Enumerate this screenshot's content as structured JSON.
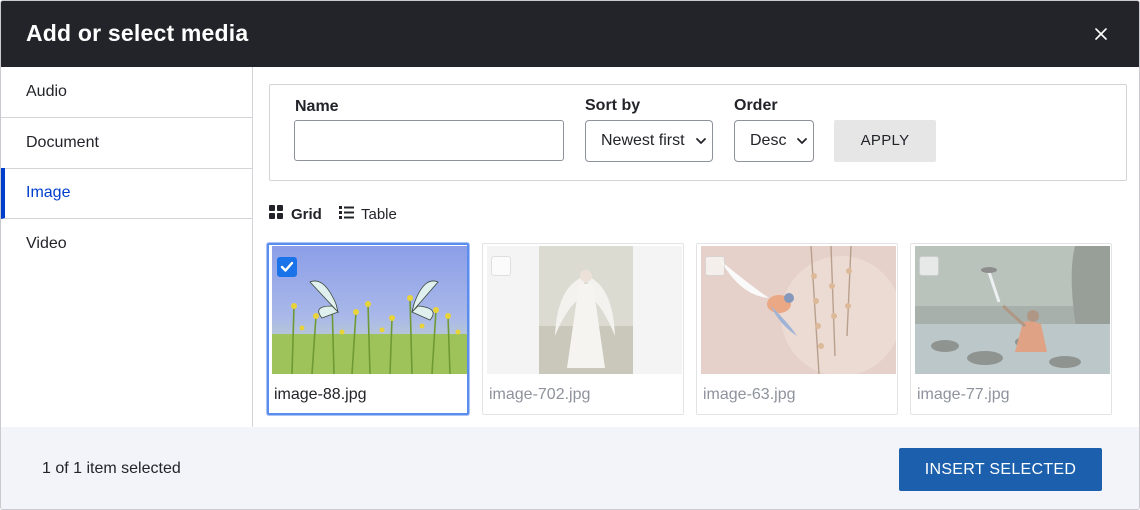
{
  "dialog": {
    "title": "Add or select media",
    "close_icon": "close-icon"
  },
  "sidebar": {
    "active": "Image",
    "items": [
      {
        "label": "Audio"
      },
      {
        "label": "Document"
      },
      {
        "label": "Image"
      },
      {
        "label": "Video"
      }
    ]
  },
  "filters": {
    "name_label": "Name",
    "name_value": "",
    "sort_label": "Sort by",
    "sort_value": "Newest first",
    "order_label": "Order",
    "order_value": "Desc",
    "apply_label": "APPLY"
  },
  "view": {
    "grid_label": "Grid",
    "table_label": "Table",
    "active": "Grid"
  },
  "media": [
    {
      "filename": "image-88.jpg",
      "selected": true
    },
    {
      "filename": "image-702.jpg",
      "selected": false
    },
    {
      "filename": "image-63.jpg",
      "selected": false
    },
    {
      "filename": "image-77.jpg",
      "selected": false
    }
  ],
  "footer": {
    "selection_text": "1 of 1 item selected",
    "insert_label": "INSERT SELECTED"
  },
  "colors": {
    "header_bg": "#232429",
    "accent": "#003ecc",
    "primary_button": "#1b5fad",
    "selected_border": "#5b8def",
    "footer_bg": "#f3f4f9"
  }
}
